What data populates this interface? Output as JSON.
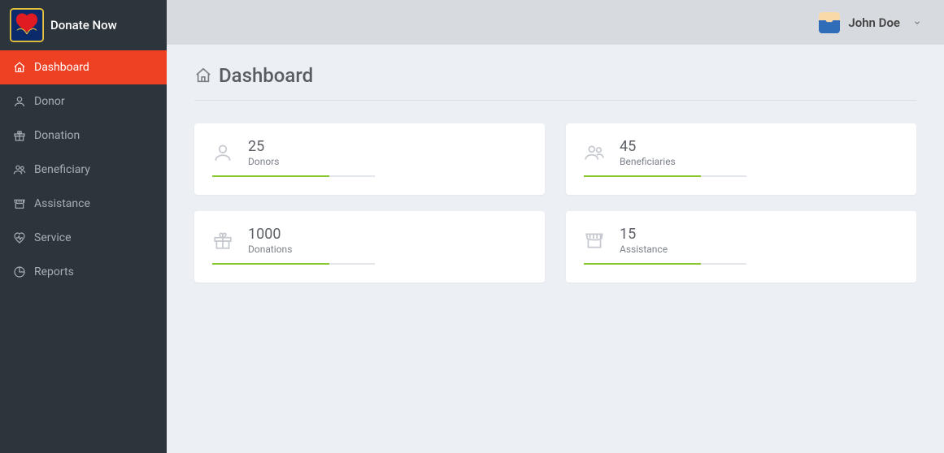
{
  "brand": {
    "title": "Donate Now"
  },
  "user": {
    "name": "John Doe"
  },
  "page": {
    "title": "Dashboard"
  },
  "nav": {
    "items": [
      {
        "label": "Dashboard"
      },
      {
        "label": "Donor"
      },
      {
        "label": "Donation"
      },
      {
        "label": "Beneficiary"
      },
      {
        "label": "Assistance"
      },
      {
        "label": "Service"
      },
      {
        "label": "Reports"
      }
    ]
  },
  "cards": {
    "donors": {
      "value": "25",
      "label": "Donors",
      "progress_pct": 72
    },
    "beneficiaries": {
      "value": "45",
      "label": "Beneficiaries",
      "progress_pct": 72
    },
    "donations": {
      "value": "1000",
      "label": "Donations",
      "progress_pct": 72
    },
    "assistance": {
      "value": "15",
      "label": "Assistance",
      "progress_pct": 72
    }
  },
  "colors": {
    "accent": "#ee4023",
    "success": "#86c82d"
  }
}
